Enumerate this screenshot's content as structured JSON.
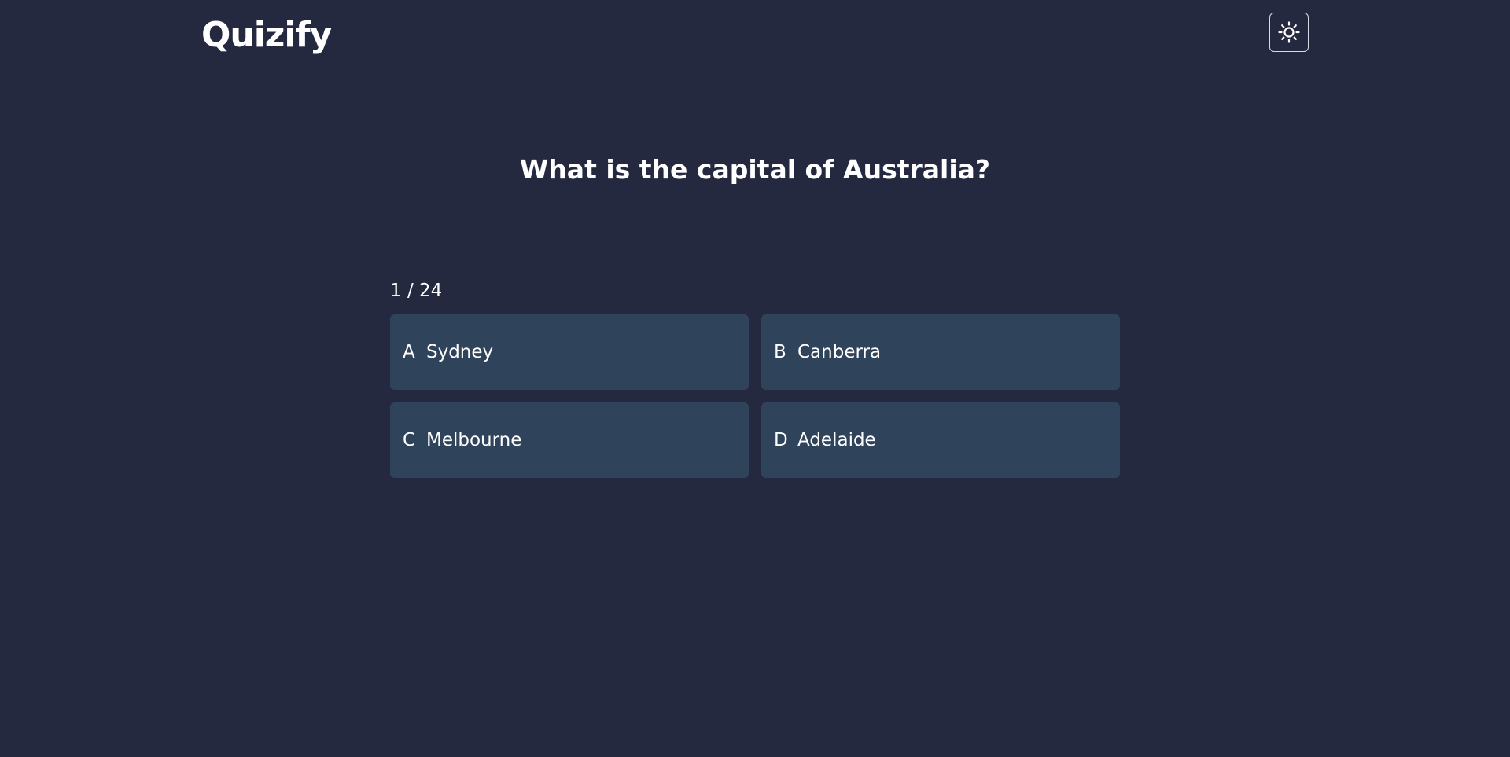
{
  "header": {
    "logo": "Quizify",
    "theme_icon": "sun-icon"
  },
  "question": {
    "text": "What is the capital of Australia?",
    "progress": "1 / 24"
  },
  "options": [
    {
      "letter": "A",
      "label": "Sydney"
    },
    {
      "letter": "B",
      "label": "Canberra"
    },
    {
      "letter": "C",
      "label": "Melbourne"
    },
    {
      "letter": "D",
      "label": "Adelaide"
    }
  ],
  "colors": {
    "background": "#252940",
    "option_background": "#2f435b",
    "text": "#ffffff"
  }
}
